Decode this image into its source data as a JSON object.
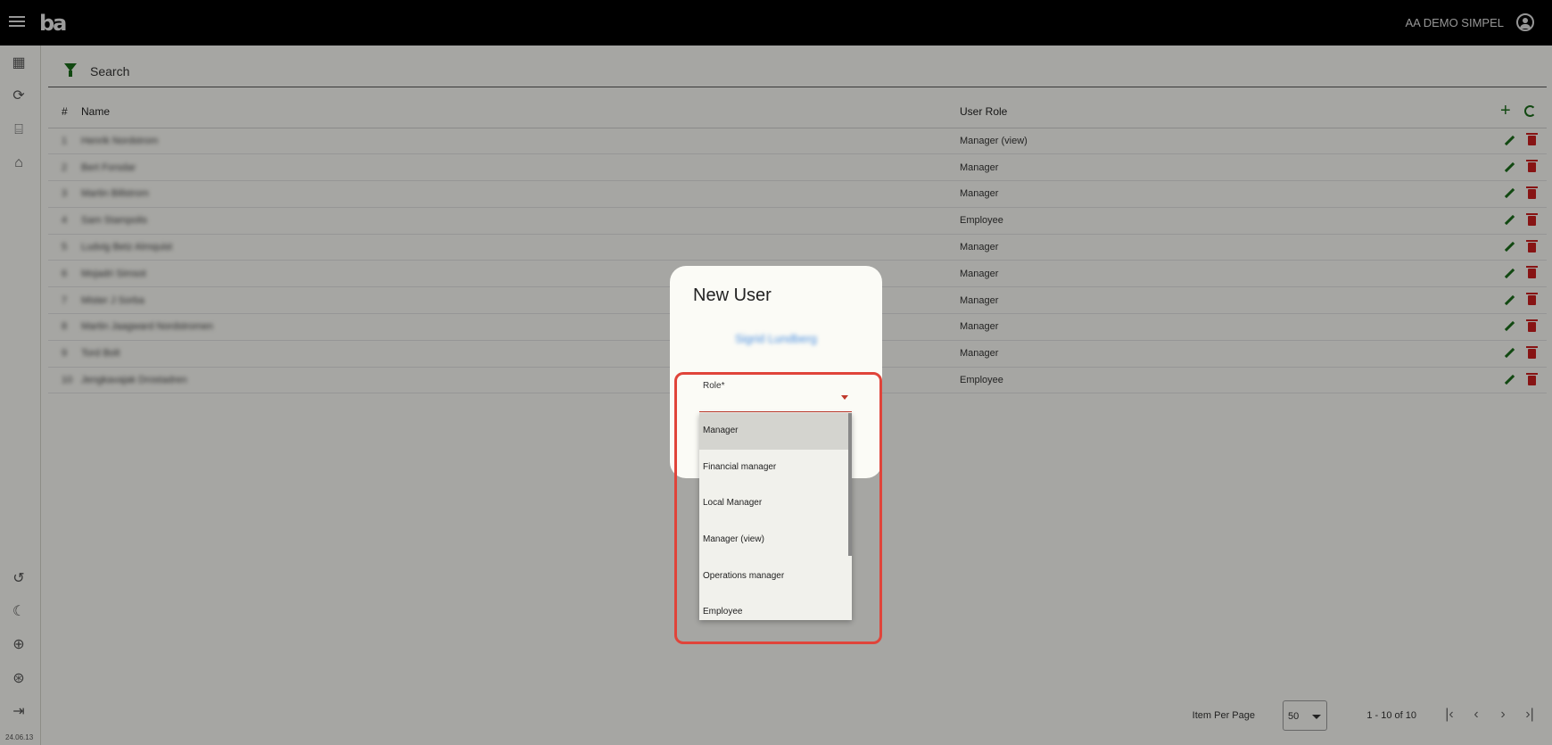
{
  "topbar": {
    "org_name": "AA DEMO SIMPEL"
  },
  "sidebar": {
    "top_icons": [
      "dashboard-icon",
      "currency-sync-icon",
      "scan-document-icon",
      "store-icon"
    ],
    "bottom_icons": [
      "history-icon",
      "dark-mode-icon",
      "globe-icon",
      "support-icon",
      "logout-icon"
    ],
    "version": "24.06.13"
  },
  "search": {
    "label": "Search"
  },
  "table": {
    "headers": {
      "num": "#",
      "name": "Name",
      "role": "User Role"
    },
    "rows": [
      {
        "num": "1",
        "name": "Henrik Nordstrom",
        "role": "Manager (view)"
      },
      {
        "num": "2",
        "name": "Bert Forsdar",
        "role": "Manager"
      },
      {
        "num": "3",
        "name": "Martin Billstrom",
        "role": "Manager"
      },
      {
        "num": "4",
        "name": "Sam Stampolis",
        "role": "Employee"
      },
      {
        "num": "5",
        "name": "Ludvig Betz Almquist",
        "role": "Manager"
      },
      {
        "num": "6",
        "name": "Mojadri Simsot",
        "role": "Manager"
      },
      {
        "num": "7",
        "name": "Mister J Sorba",
        "role": "Manager"
      },
      {
        "num": "8",
        "name": "Martin Jaagward Nordstromen",
        "role": "Manager"
      },
      {
        "num": "9",
        "name": "Tord Bolt",
        "role": "Manager"
      },
      {
        "num": "10",
        "name": "Jengkavajak Drostadren",
        "role": "Employee"
      }
    ]
  },
  "pager": {
    "label": "Item Per Page",
    "per_page": "50",
    "range": "1 - 10 of 10"
  },
  "dialog": {
    "title": "New User",
    "user_name": "Sigrid Lundberg",
    "role_label": "Role*",
    "role_options": [
      "Manager",
      "Financial manager",
      "Local Manager",
      "Manager (view)",
      "Operations manager",
      "Employee"
    ]
  },
  "colors": {
    "accent_green": "#1a6a1a",
    "delete_red": "#c81e1e",
    "highlight": "#e0443a"
  }
}
